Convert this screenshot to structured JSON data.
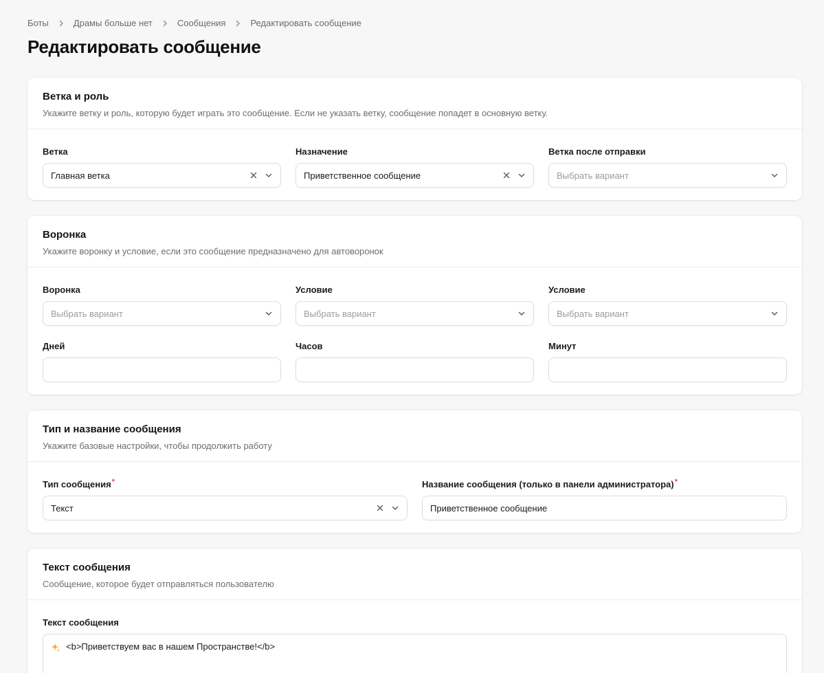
{
  "breadcrumb": [
    "Боты",
    "Драмы больше нет",
    "Сообщения",
    "Редактировать сообщение"
  ],
  "page_title": "Редактировать сообщение",
  "sections": {
    "branch": {
      "title": "Ветка и роль",
      "desc": "Укажите ветку и роль, которую будет играть это сообщение. Если не указать ветку, сообщение попадет в основную ветку.",
      "fields": {
        "branch": {
          "label": "Ветка",
          "value": "Главная ветка"
        },
        "purpose": {
          "label": "Назначение",
          "value": "Приветственное сообщение"
        },
        "after": {
          "label": "Ветка после отправки",
          "placeholder": "Выбрать вариант"
        }
      }
    },
    "funnel": {
      "title": "Воронка",
      "desc": "Укажите воронку и условие, если это сообщение предназначено для автоворонок",
      "fields": {
        "funnel": {
          "label": "Воронка",
          "placeholder": "Выбрать вариант"
        },
        "cond1": {
          "label": "Условие",
          "placeholder": "Выбрать вариант"
        },
        "cond2": {
          "label": "Условие",
          "placeholder": "Выбрать вариант"
        },
        "days": {
          "label": "Дней",
          "value": ""
        },
        "hours": {
          "label": "Часов",
          "value": ""
        },
        "minutes": {
          "label": "Минут",
          "value": ""
        }
      }
    },
    "type": {
      "title": "Тип и название сообщения",
      "desc": "Укажите базовые настройки, чтобы продолжить работу",
      "fields": {
        "msg_type": {
          "label": "Тип сообщения",
          "required_mark": "*",
          "value": "Текст"
        },
        "msg_name": {
          "label": "Название сообщения (только в панели администратора)",
          "required_mark": "*",
          "value": "Приветственное сообщение"
        }
      }
    },
    "text": {
      "title": "Текст сообщения",
      "desc": "Сообщение, которое будет отправляться пользователю",
      "fields": {
        "msg_text": {
          "label": "Текст сообщения",
          "line1": "<b>Приветствуем вас в нашем Пространстве!</b>"
        }
      }
    }
  },
  "icons": {
    "breadcrumb_separator": "chevron-right-icon",
    "clear": "close-icon",
    "dropdown": "chevron-down-icon",
    "emoji": "sparkles-icon"
  },
  "colors": {
    "required": "#e5484d",
    "emoji": "#f5a524"
  }
}
